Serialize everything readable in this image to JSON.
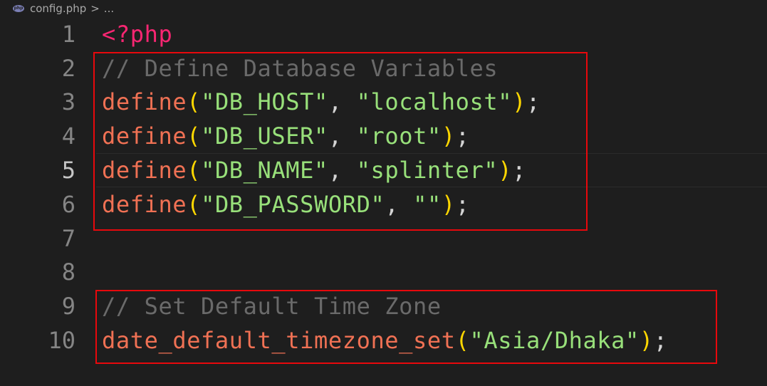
{
  "breadcrumb": {
    "file_icon": "php-file-icon",
    "file_icon_label": "php",
    "file_name": "config.php",
    "separator": ">",
    "more": "..."
  },
  "editor": {
    "current_line": 5,
    "lines": [
      {
        "number": "1",
        "open_tag": "<?php"
      },
      {
        "number": "2",
        "comment": "// Define Database Variables"
      },
      {
        "number": "3",
        "fn": "define",
        "open": "(",
        "arg1": "\"DB_HOST\"",
        "comma": ", ",
        "arg2": "\"localhost\"",
        "close": ")",
        "semi": ";"
      },
      {
        "number": "4",
        "fn": "define",
        "open": "(",
        "arg1": "\"DB_USER\"",
        "comma": ", ",
        "arg2": "\"root\"",
        "close": ")",
        "semi": ";"
      },
      {
        "number": "5",
        "fn": "define",
        "open": "(",
        "arg1": "\"DB_NAME\"",
        "comma": ", ",
        "arg2": "\"splinter\"",
        "close": ")",
        "semi": ";"
      },
      {
        "number": "6",
        "fn": "define",
        "open": "(",
        "arg1": "\"DB_PASSWORD\"",
        "comma": ", ",
        "arg2": "\"\"",
        "close": ")",
        "semi": ";"
      },
      {
        "number": "7"
      },
      {
        "number": "8"
      },
      {
        "number": "9",
        "comment": "// Set Default Time Zone"
      },
      {
        "number": "10",
        "fn": "date_default_timezone_set",
        "open": "(",
        "arg1": "\"Asia/Dhaka\"",
        "close": ")",
        "semi": ";"
      }
    ]
  },
  "colors": {
    "highlight_box": "#e8080c",
    "background": "#1e1e1e",
    "function": "#f07154",
    "string": "#98e07a",
    "paren": "#ffd700",
    "comment": "#6a6a6a",
    "tag": "#f92672"
  }
}
